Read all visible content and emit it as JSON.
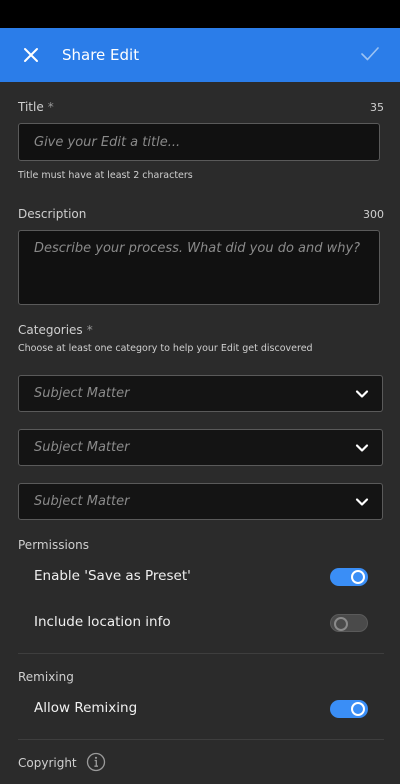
{
  "header": {
    "title": "Share Edit",
    "close_icon": "close-icon",
    "confirm_icon": "checkmark-icon",
    "accent_color": "#2b7de9"
  },
  "title_field": {
    "label": "Title",
    "required_mark": "*",
    "char_count": "35",
    "placeholder": "Give your Edit a title...",
    "value": "",
    "helper": "Title must have at least 2 characters"
  },
  "description_field": {
    "label": "Description",
    "char_count": "300",
    "placeholder": "Describe your process. What did you do and why?",
    "value": ""
  },
  "categories": {
    "label": "Categories",
    "required_mark": "*",
    "helper": "Choose at least one category to help your Edit get discovered",
    "selects": [
      {
        "placeholder": "Subject Matter"
      },
      {
        "placeholder": "Subject Matter"
      },
      {
        "placeholder": "Subject Matter"
      }
    ]
  },
  "permissions": {
    "label": "Permissions",
    "items": [
      {
        "label": "Enable 'Save as Preset'",
        "on": true
      },
      {
        "label": "Include location info",
        "on": false
      }
    ]
  },
  "remixing": {
    "label": "Remixing",
    "items": [
      {
        "label": "Allow Remixing",
        "on": true
      }
    ]
  },
  "copyright": {
    "label": "Copyright",
    "info_icon": "info-icon"
  }
}
